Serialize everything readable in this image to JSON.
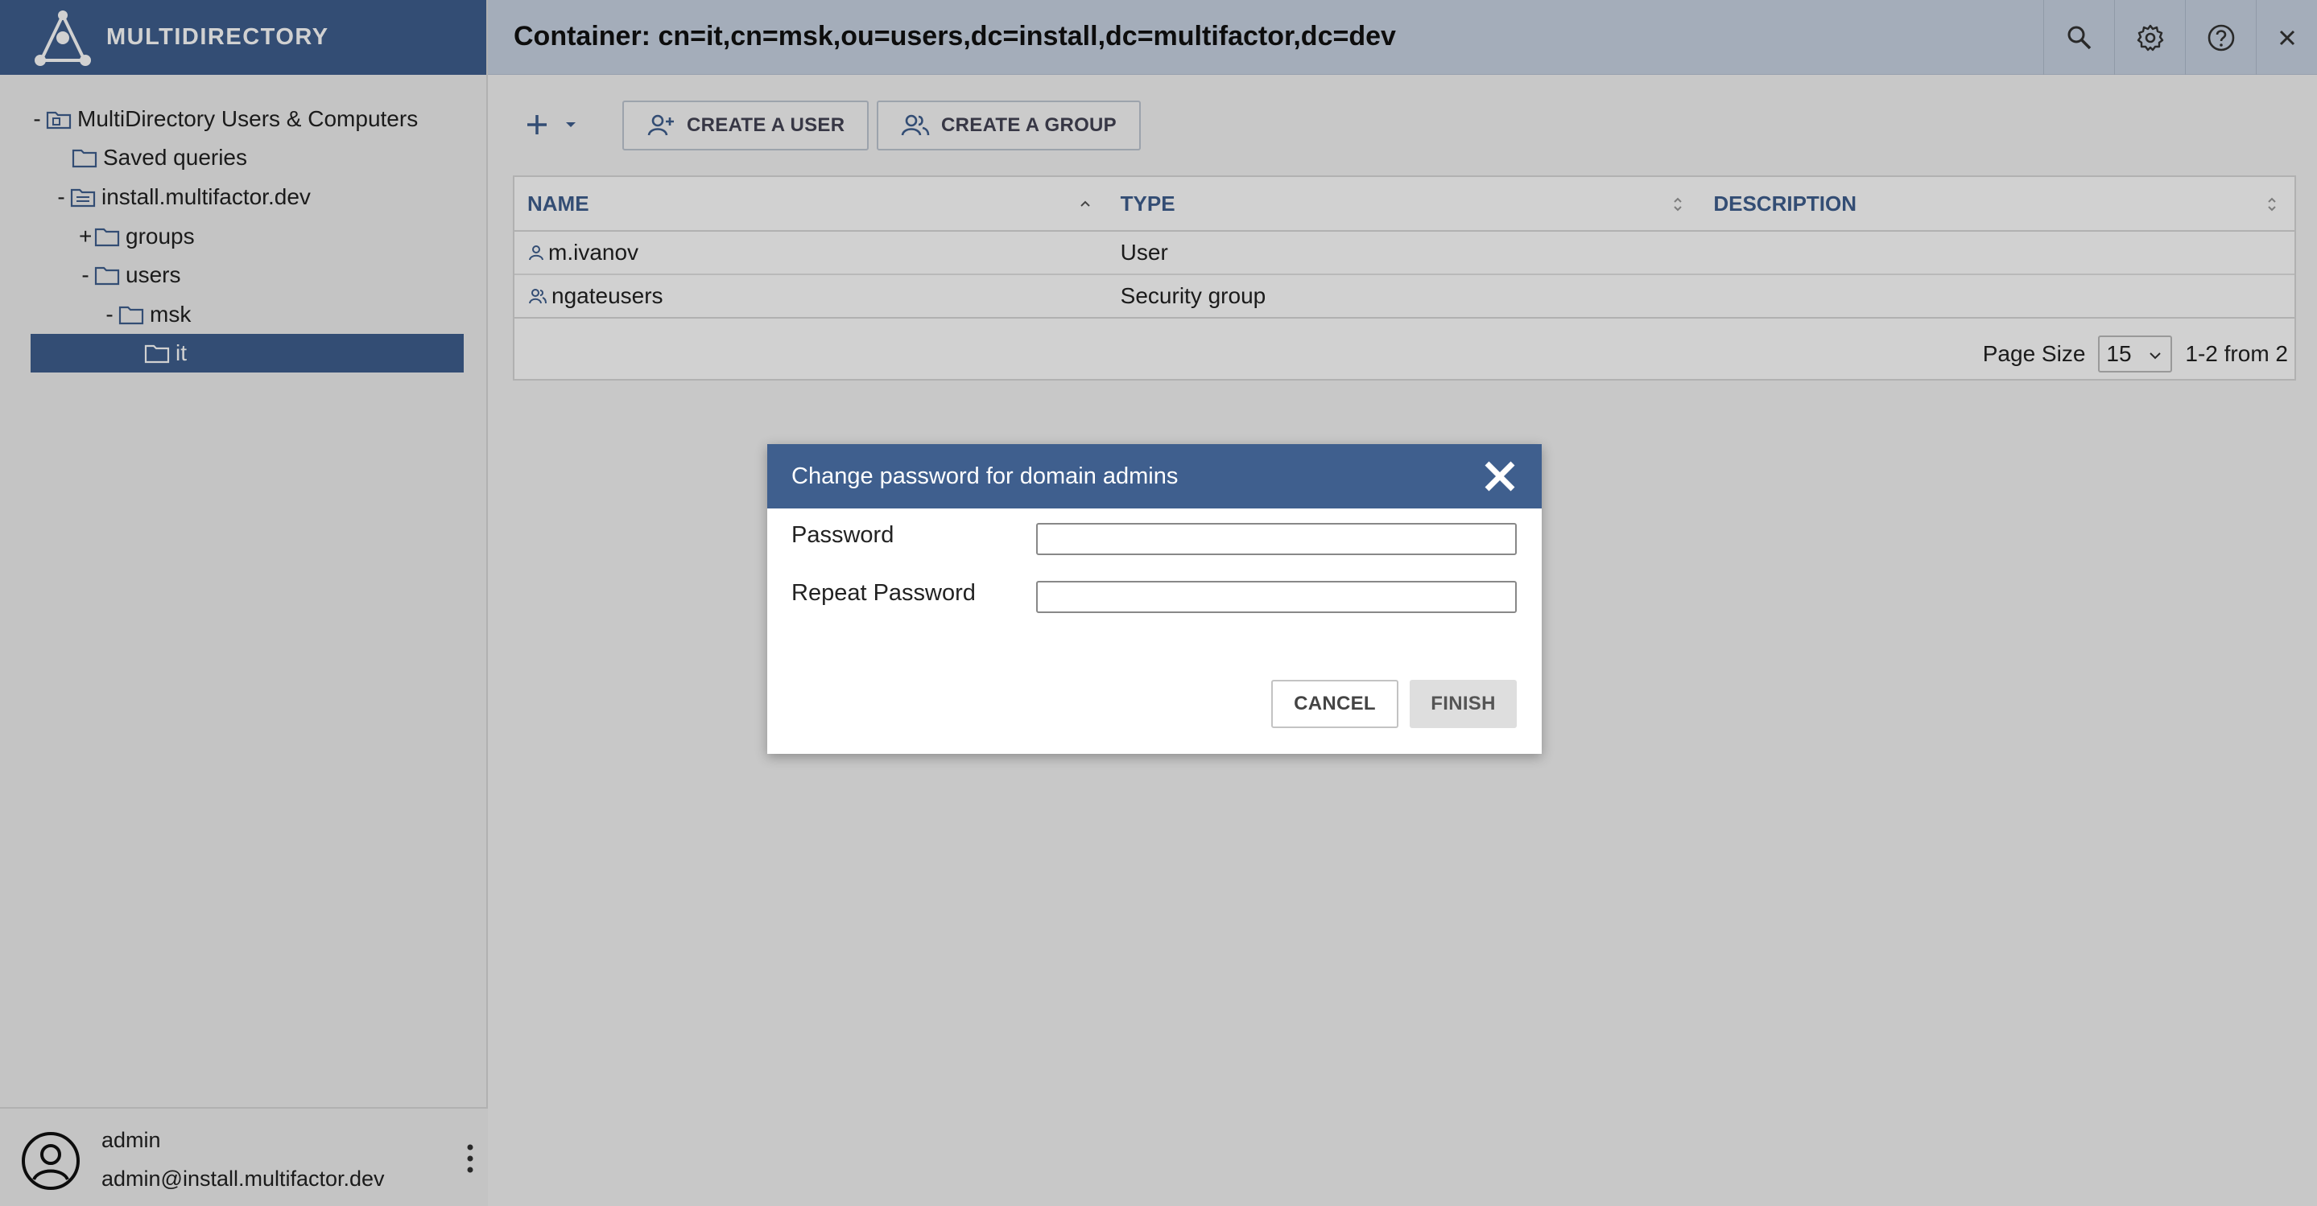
{
  "app": {
    "name": "MULTIDIRECTORY",
    "container_title": "Container: cn=it,cn=msk,ou=users,dc=install,dc=multifactor,dc=dev"
  },
  "header_icons": [
    "search-icon",
    "gear-icon",
    "help-icon",
    "close-icon"
  ],
  "tree": {
    "root": {
      "toggle": "-",
      "label": "MultiDirectory Users & Computers"
    },
    "saved": {
      "label": "Saved queries"
    },
    "domain": {
      "toggle": "-",
      "label": "install.multifactor.dev"
    },
    "groups": {
      "toggle": "+",
      "label": "groups"
    },
    "users": {
      "toggle": "-",
      "label": "users"
    },
    "msk": {
      "toggle": "-",
      "label": "msk"
    },
    "it": {
      "label": "it"
    }
  },
  "toolbar": {
    "create_user": "CREATE A USER",
    "create_group": "CREATE A GROUP"
  },
  "table": {
    "columns": [
      "NAME",
      "TYPE",
      "DESCRIPTION"
    ],
    "rows": [
      {
        "name": "m.ivanov",
        "type": "User",
        "description": "",
        "icon": "user-icon"
      },
      {
        "name": "ngateusers",
        "type": "Security group",
        "description": "",
        "icon": "group-icon"
      }
    ],
    "page_size_label": "Page Size",
    "page_size": "15",
    "range": "1-2 from 2"
  },
  "user": {
    "name": "admin",
    "email": "admin@install.multifactor.dev"
  },
  "dialog": {
    "title": "Change password for domain admins",
    "password_label": "Password",
    "repeat_label": "Repeat Password",
    "password_value": "",
    "repeat_value": "",
    "cancel": "CANCEL",
    "finish": "FINISH"
  },
  "colors": {
    "brand": "#3f5f8e",
    "header_bg": "#c9d4e3",
    "selected": "#3f5f8e"
  }
}
